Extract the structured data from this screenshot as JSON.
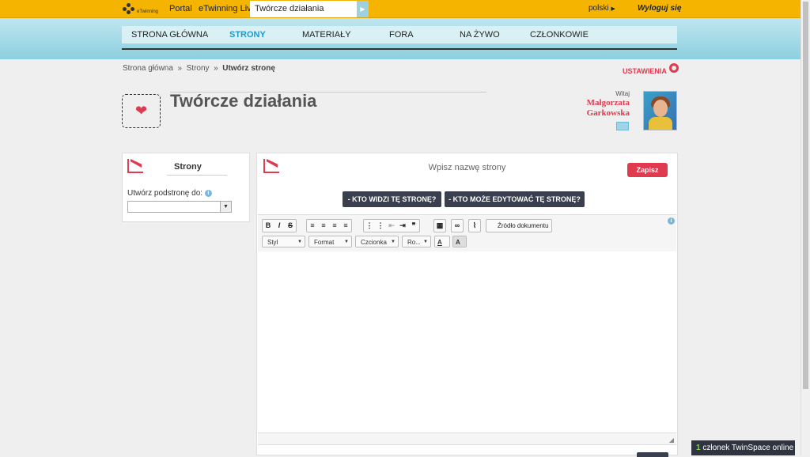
{
  "topbar": {
    "logo_text": "eTwinning",
    "portal": "Portal",
    "live": "eTwinning Live",
    "active_tab": "Twórcze działania",
    "language": "polski",
    "logout": "Wyloguj się"
  },
  "mainnav": [
    "STRONA GŁÓWNA",
    "STRONY",
    "MATERIAŁY",
    "FORA",
    "NA ŻYWO",
    "CZŁONKOWIE"
  ],
  "breadcrumb": {
    "home": "Strona główna",
    "sep1": "»",
    "pages": "Strony",
    "sep2": "»",
    "current": "Utwórz stronę"
  },
  "settings_label": "USTAWIENIA",
  "page_title": "Twórcze działania",
  "user": {
    "welcome": "Witaj",
    "first_name": "Małgorzata",
    "last_name": "Garkowska"
  },
  "left_panel": {
    "title": "Strony",
    "subpage_label": "Utwórz podstronę do:",
    "info_glyph": "i"
  },
  "editor": {
    "page_name_placeholder": "Wpisz nazwę strony",
    "save_button": "Zapisz",
    "who_sees": "- KTO WIDZI TĘ STRONĘ?",
    "who_edits": "- KTO MOŻE EDYTOWAĆ TĘ STRONĘ?",
    "source_button": "Źródło dokumentu",
    "style_combo": "Styl",
    "format_combo": "Format",
    "font_combo": "Czcionka",
    "size_combo": "Ro...",
    "text_color": "A",
    "bg_color": "A"
  },
  "online": {
    "count": "1",
    "label": "członek TwinSpace online"
  }
}
